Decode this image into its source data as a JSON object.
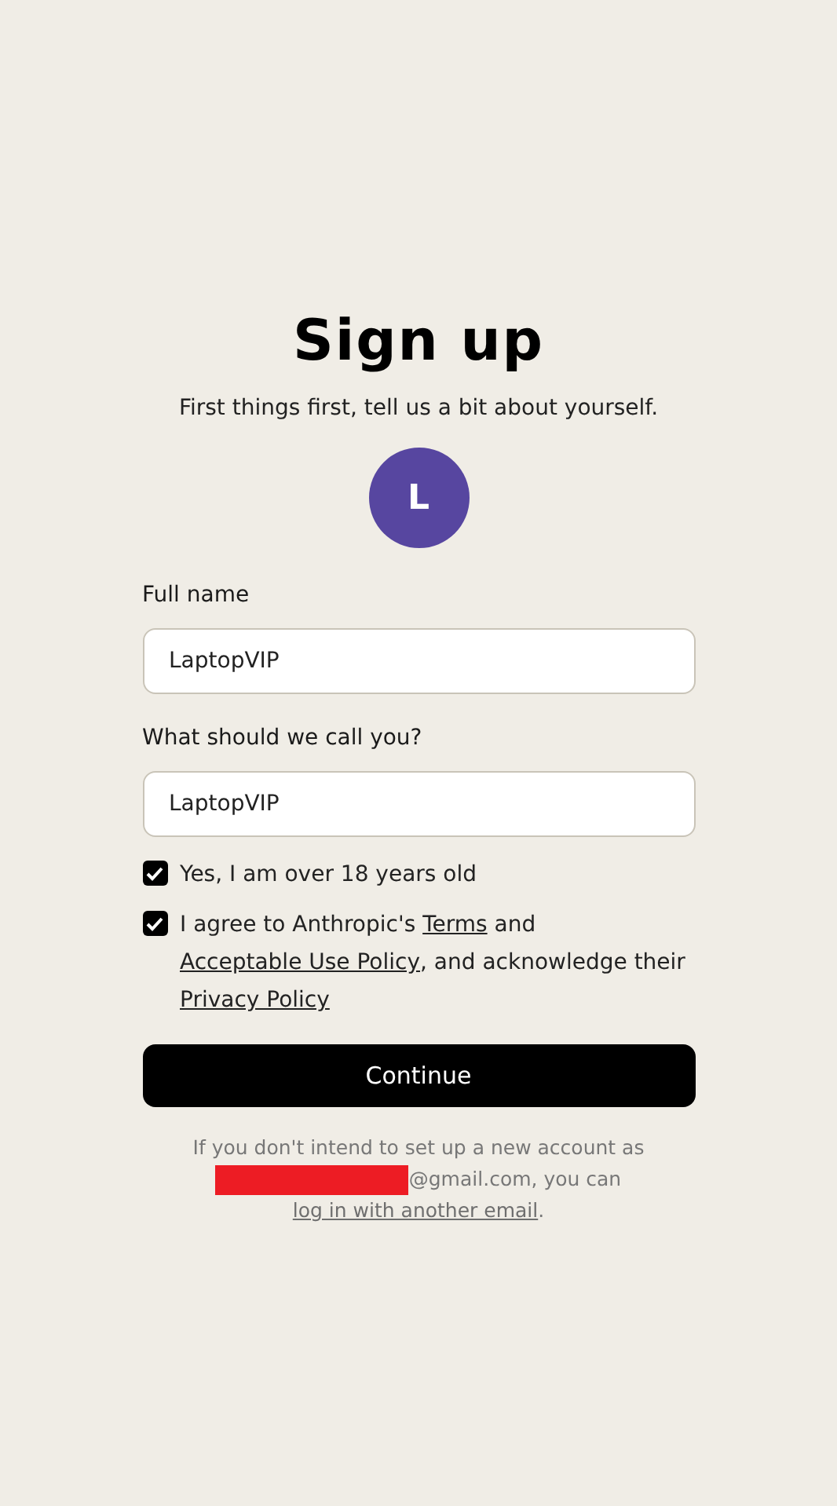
{
  "title": "Sign up",
  "subtitle": "First things first, tell us a bit about yourself.",
  "avatar": {
    "initial": "L",
    "color": "#5746a0"
  },
  "fields": [
    {
      "label": "Full name",
      "value": "LaptopVIP"
    },
    {
      "label": "What should we call you?",
      "value": "LaptopVIP"
    }
  ],
  "checks": [
    {
      "checked": true,
      "segments": [
        {
          "kind": "text",
          "text": "Yes, I am over 18 years old"
        }
      ]
    },
    {
      "checked": true,
      "segments": [
        {
          "kind": "text",
          "text": "I agree to Anthropic's "
        },
        {
          "kind": "link",
          "text": "Terms"
        },
        {
          "kind": "text",
          "text": " and "
        },
        {
          "kind": "link",
          "text": "Acceptable Use Policy"
        },
        {
          "kind": "text",
          "text": ", and acknowledge their "
        },
        {
          "kind": "link",
          "text": "Privacy Policy"
        }
      ]
    }
  ],
  "button": "Continue",
  "footer": [
    {
      "kind": "text",
      "text": "If you don't intend to set up a new account as "
    },
    {
      "kind": "redacted"
    },
    {
      "kind": "text",
      "text": "@gmail.com, you can "
    },
    {
      "kind": "link",
      "text": "log in with another email"
    },
    {
      "kind": "text",
      "text": "."
    }
  ]
}
